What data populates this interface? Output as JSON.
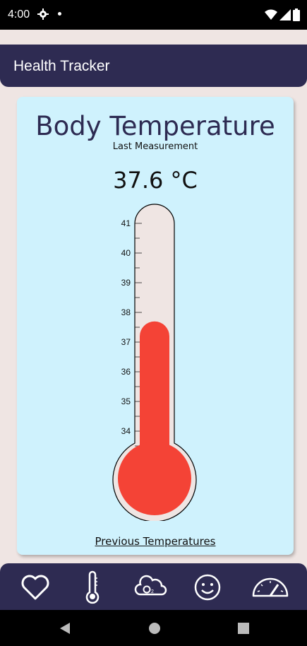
{
  "status": {
    "time": "4:00"
  },
  "app": {
    "title": "Health Tracker"
  },
  "card": {
    "title": "Body Temperature",
    "subtitle": "Last Measurement",
    "reading": "37.6 °C",
    "temperature_value": 37.6,
    "scale_min": 34,
    "scale_max": 41,
    "scale_labels": [
      "41",
      "40",
      "39",
      "38",
      "37",
      "36",
      "35",
      "34"
    ],
    "link": "Previous Temperatures"
  },
  "colors": {
    "accent": "#f44336",
    "header": "#2e2b52",
    "card": "#cff2fd"
  },
  "nav": {
    "items": [
      {
        "name": "heart-icon"
      },
      {
        "name": "thermometer-icon"
      },
      {
        "name": "oxygen-icon"
      },
      {
        "name": "smiley-icon"
      },
      {
        "name": "gauge-icon"
      }
    ]
  }
}
